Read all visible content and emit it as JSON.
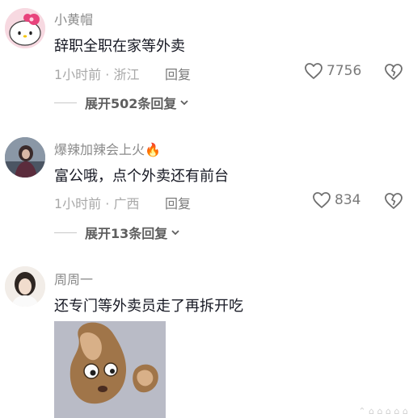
{
  "comments": [
    {
      "username": "小黄帽",
      "text": "辞职全职在家等外卖",
      "time_location": "1小时前 · 浙江",
      "reply_label": "回复",
      "likes": "7756",
      "expand_label": "展开502条回复"
    },
    {
      "username": "爆辣加辣会上火",
      "username_emoji": "🔥",
      "text": "富公哦，点个外卖还有前台",
      "time_location": "1小时前 · 广西",
      "reply_label": "回复",
      "likes": "834",
      "expand_label": "展开13条回复"
    },
    {
      "username": "周周一",
      "text": "还专门等外卖员走了再拆开吃"
    }
  ],
  "icons": {
    "like": "heart-outline-icon",
    "dislike": "broken-heart-icon",
    "expand": "chevron-down-icon"
  },
  "colors": {
    "primary_text": "#161823",
    "secondary_text": "#8a8a8a",
    "background": "#ffffff"
  }
}
